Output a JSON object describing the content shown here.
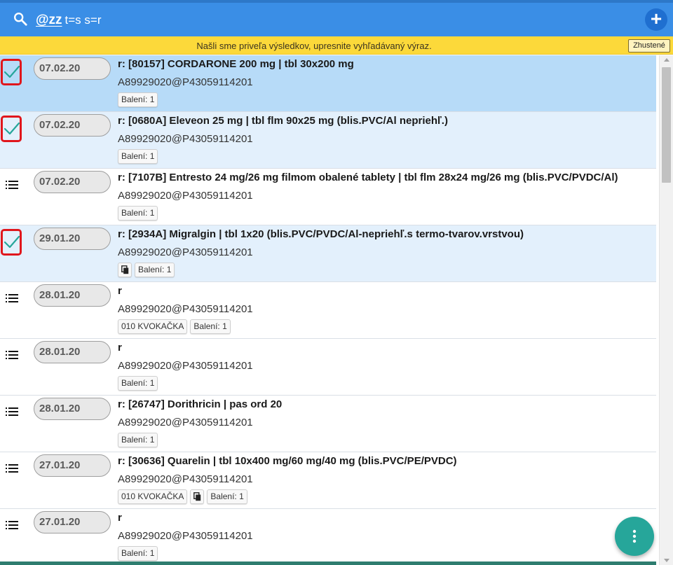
{
  "search": {
    "prefix": "@zz",
    "query": "t=s s=r"
  },
  "notice": {
    "text": "Našli sme priveľa výsledkov, upresnite vyhľadávaný výraz.",
    "dense_label": "Zhustené"
  },
  "colors": {
    "header": "#3a8ee6",
    "notice": "#fcd93a",
    "fab": "#26a69a",
    "selected": "#e3f0fc",
    "highlight": "#e0161c"
  },
  "rows": [
    {
      "state": "checked",
      "date": "07.02.20",
      "title": "r: [80157] CORDARONE 200 mg | tbl 30x200 mg",
      "code": "A89929020@P43059114201",
      "tags": [
        "Balení: 1"
      ],
      "copy_icon": false
    },
    {
      "state": "checked",
      "date": "07.02.20",
      "title": "r: [0680A] Eleveon 25 mg | tbl flm 90x25 mg (blis.PVC/Al nepriehľ.)",
      "code": "A89929020@P43059114201",
      "tags": [
        "Balení: 1"
      ],
      "copy_icon": false
    },
    {
      "state": "menu",
      "date": "07.02.20",
      "title": "r: [7107B] Entresto 24 mg/26 mg filmom obalené tablety | tbl flm 28x24 mg/26 mg (blis.PVC/PVDC/Al)",
      "code": "A89929020@P43059114201",
      "tags": [
        "Balení: 1"
      ],
      "copy_icon": false
    },
    {
      "state": "checked",
      "date": "29.01.20",
      "title": "r: [2934A] Migralgin | tbl 1x20 (blis.PVC/PVDC/Al-nepriehľ.s termo-tvarov.vrstvou)",
      "code": "A89929020@P43059114201",
      "tags": [
        "Balení: 1"
      ],
      "copy_icon": true
    },
    {
      "state": "menu",
      "date": "28.01.20",
      "title": "r",
      "code": "A89929020@P43059114201",
      "tags": [
        "010 KVOKAČKA",
        "Balení: 1"
      ],
      "copy_icon": false
    },
    {
      "state": "menu",
      "date": "28.01.20",
      "title": "r",
      "code": "A89929020@P43059114201",
      "tags": [
        "Balení: 1"
      ],
      "copy_icon": false
    },
    {
      "state": "menu",
      "date": "28.01.20",
      "title": "r: [26747] Dorithricin | pas ord 20",
      "code": "A89929020@P43059114201",
      "tags": [
        "Balení: 1"
      ],
      "copy_icon": false
    },
    {
      "state": "menu",
      "date": "27.01.20",
      "title": "r: [30636] Quarelin | tbl 10x400 mg/60 mg/40 mg (blis.PVC/PE/PVDC)",
      "code": "A89929020@P43059114201",
      "tags": [
        "010 KVOKAČKA",
        "Balení: 1"
      ],
      "copy_icon": true
    },
    {
      "state": "menu",
      "date": "27.01.20",
      "title": "r",
      "code": "A89929020@P43059114201",
      "tags": [
        "Balení: 1"
      ],
      "copy_icon": false
    }
  ]
}
